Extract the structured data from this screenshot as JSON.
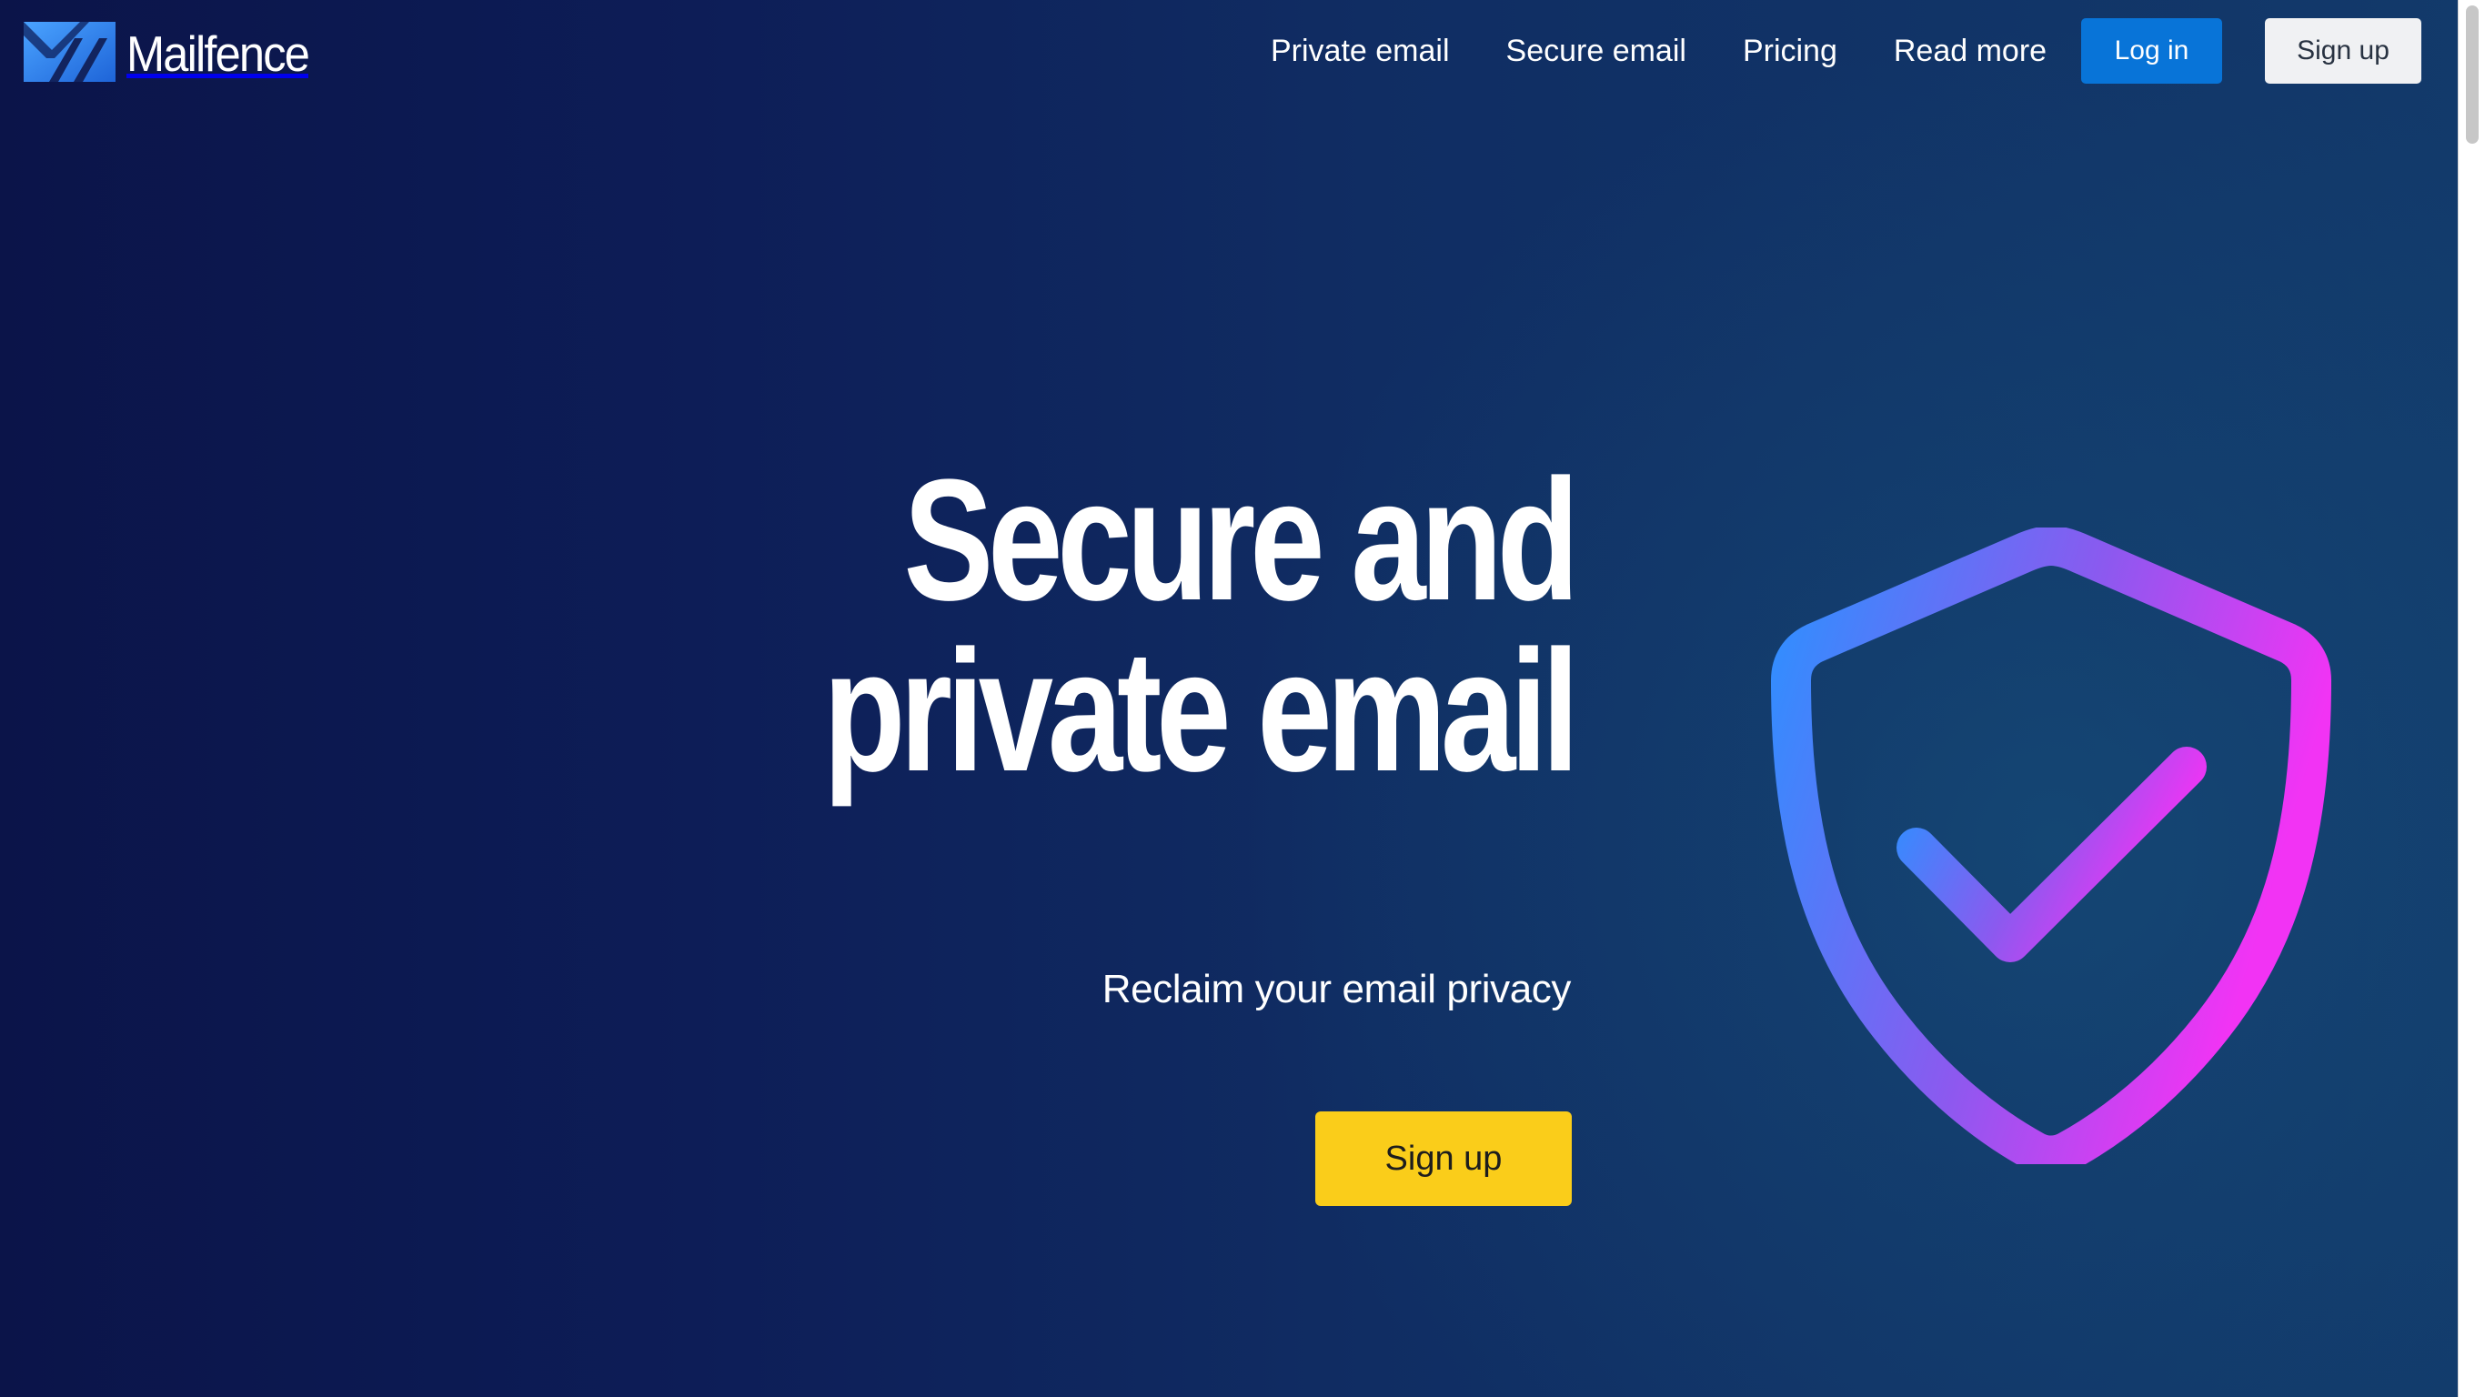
{
  "header": {
    "brand": {
      "name": "Mailfence",
      "logo_icon": "mailfence-mark-icon"
    },
    "nav": [
      {
        "label": "Private email"
      },
      {
        "label": "Secure email"
      },
      {
        "label": "Pricing"
      },
      {
        "label": "Read more"
      }
    ],
    "login_label": "Log in",
    "signup_label": "Sign up"
  },
  "hero": {
    "title": "Secure and private email",
    "subtitle": "Reclaim your email privacy",
    "cta_label": "Sign up",
    "illustration": {
      "icon": "shield-check-icon",
      "gradient_start": "#2f8fff",
      "gradient_end": "#f233f4"
    }
  },
  "colors": {
    "background_left": "#0b1449",
    "background_right": "#123a6b",
    "login_button": "#0874d8",
    "cta_button": "#facd1a"
  }
}
